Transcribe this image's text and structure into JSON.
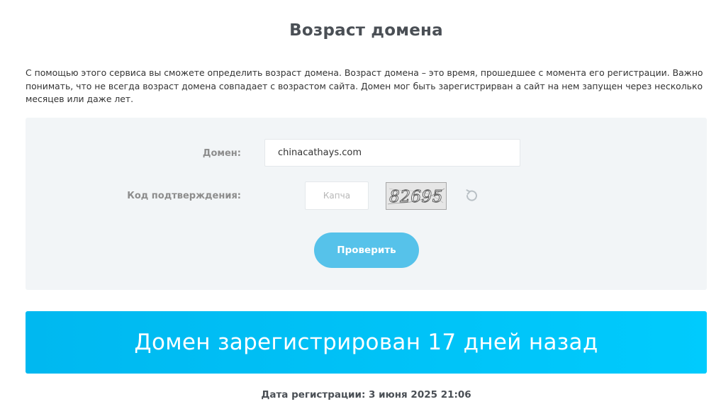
{
  "page": {
    "title": "Возраст домена",
    "description": "С помощью этого сервиса вы сможете определить возраст домена. Возраст домена – это время, прошедшее с момента его регистрации. Важно понимать, что не всегда возраст домена совпадает с возрастом сайта. Домен мог быть зарегистрирван а сайт на нем запущен через несколько месяцев или даже лет."
  },
  "form": {
    "domain_label": "Домен:",
    "domain_value": "chinacathays.com",
    "captcha_label": "Код подтверждения:",
    "captcha_placeholder": "Капча",
    "captcha_image_text": "82695",
    "refresh_icon": "refresh-icon",
    "submit_label": "Проверить"
  },
  "result": {
    "headline": "Домен зарегистрирован 17 дней назад",
    "registration_date": "Дата регистрации: 3 июня 2025 21:06"
  },
  "colors": {
    "button": "#56c2ea",
    "banner": "#00c3f8",
    "panel": "#f2f5f7",
    "title": "#4a4f55"
  }
}
